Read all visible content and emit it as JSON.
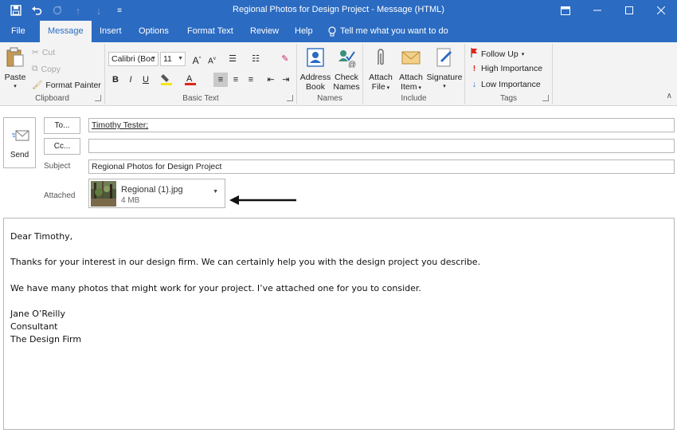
{
  "window": {
    "title": "Regional Photos for Design Project  -  Message (HTML)",
    "controls": [
      "ribbon-display-icon",
      "minimize-icon",
      "restore-icon",
      "close-icon"
    ]
  },
  "quick_access": [
    "save-icon",
    "undo-icon",
    "redo-icon",
    "up-arrow-icon",
    "down-arrow-icon",
    "customize-icon"
  ],
  "tabs": [
    {
      "label": "File"
    },
    {
      "label": "Message"
    },
    {
      "label": "Insert"
    },
    {
      "label": "Options"
    },
    {
      "label": "Format Text"
    },
    {
      "label": "Review"
    },
    {
      "label": "Help"
    }
  ],
  "tell_me": "Tell me what you want to do",
  "ribbon": {
    "clipboard": {
      "label": "Clipboard",
      "paste": "Paste",
      "cut": "Cut",
      "copy": "Copy",
      "format_painter": "Format Painter"
    },
    "basic_text": {
      "label": "Basic Text",
      "font": "Calibri (Boc",
      "size": "11",
      "grow": "A",
      "shrink": "A",
      "bold": "B",
      "italic": "I",
      "underline": "U"
    },
    "names": {
      "label": "Names",
      "address_book": [
        "Address",
        "Book"
      ],
      "check_names": [
        "Check",
        "Names"
      ]
    },
    "include": {
      "label": "Include",
      "attach_file": [
        "Attach",
        "File"
      ],
      "attach_item": [
        "Attach",
        "Item"
      ],
      "signature": "Signature"
    },
    "tags": {
      "label": "Tags",
      "follow_up": "Follow Up",
      "high": "High Importance",
      "low": "Low Importance"
    }
  },
  "header": {
    "send": "Send",
    "to_button": "To...",
    "cc_button": "Cc...",
    "to_value": "Timothy Tester;",
    "cc_value": "",
    "subject_label": "Subject",
    "subject_value": "Regional Photos for Design Project",
    "attached_label": "Attached",
    "attachment": {
      "name": "Regional (1).jpg",
      "size": "4 MB"
    }
  },
  "body": [
    "Dear Timothy,",
    "Thanks for your interest in our design firm. We can certainly help you with the design project you describe.",
    "We have many photos that might work for your project. I’ve attached one for you to consider.",
    "Jane O’Reilly",
    "Consultant",
    "The Design Firm"
  ],
  "colors": {
    "accent": "#2b6bc2",
    "ribbon_bg": "#f3f3f3",
    "highlight_yellow": "#f5e616",
    "font_red": "#e0251b",
    "flag_red": "#e0251b"
  }
}
